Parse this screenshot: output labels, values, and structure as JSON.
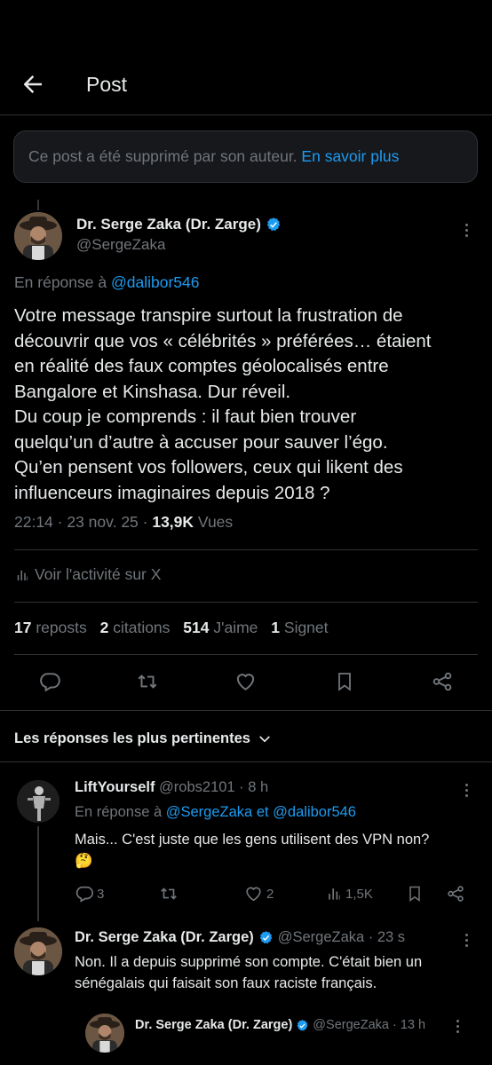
{
  "header": {
    "title": "Post"
  },
  "deleted_notice": {
    "text": "Ce post a été supprimé par son auteur.",
    "link": "En savoir plus"
  },
  "main_post": {
    "author_name": "Dr. Serge Zaka (Dr. Zarge)",
    "handle": "@SergeZaka",
    "reply_prefix": "En réponse à",
    "reply_to": "@dalibor546",
    "body_lines": [
      "Votre message transpire surtout la frustration de",
      "découvrir que vos « célébrités » préférées… étaient",
      "en réalité des faux comptes géolocalisés entre",
      "Bangalore et Kinshasa. Dur réveil.",
      "Du coup je comprends : il faut bien trouver",
      "quelqu’un d’autre à accuser pour sauver l’égo.",
      "Qu’en pensent vos followers, ceux qui likent des",
      "influenceurs imaginaires depuis 2018 ?"
    ],
    "time": "22:14 · 23 nov. 25 ·",
    "views_count": "13,9K",
    "views_label": "Vues",
    "activity_link": "Voir l'activité sur X",
    "stats": {
      "reposts_count": "17",
      "reposts_label": "reposts",
      "quotes_count": "2",
      "quotes_label": "citations",
      "likes_count": "514",
      "likes_label": "J'aime",
      "bookmarks_count": "1",
      "bookmarks_label": "Signet"
    }
  },
  "replies_header": {
    "label": "Les réponses les plus pertinentes"
  },
  "reply1": {
    "author_name": "LiftYourself",
    "handle_time": "@robs2101 · 8 h",
    "reply_prefix": "En réponse à",
    "reply_to_1": "@SergeZaka",
    "reply_and": "et",
    "reply_to_2": "@dalibor546",
    "body": "Mais... C'est juste que les gens utilisent des VPN non?",
    "emoji": "🤔",
    "replies_count": "3",
    "likes_count": "2",
    "views_count": "1,5K"
  },
  "reply2": {
    "author_name": "Dr. Serge Zaka (Dr. Zarge)",
    "handle_time": "@SergeZaka · 23 s",
    "body_lines": [
      "Non. Il a depuis supprimé son compte. C'était bien un",
      "sénégalais qui faisait son faux raciste français."
    ]
  },
  "reply3": {
    "author_name": "Dr. Serge Zaka (Dr. Zarge)",
    "handle_time": "@SergeZaka · 13 h"
  },
  "colors": {
    "accent": "#1d9bf0",
    "text": "#e7e9ea",
    "muted": "#71767b",
    "border": "#2f3336"
  }
}
